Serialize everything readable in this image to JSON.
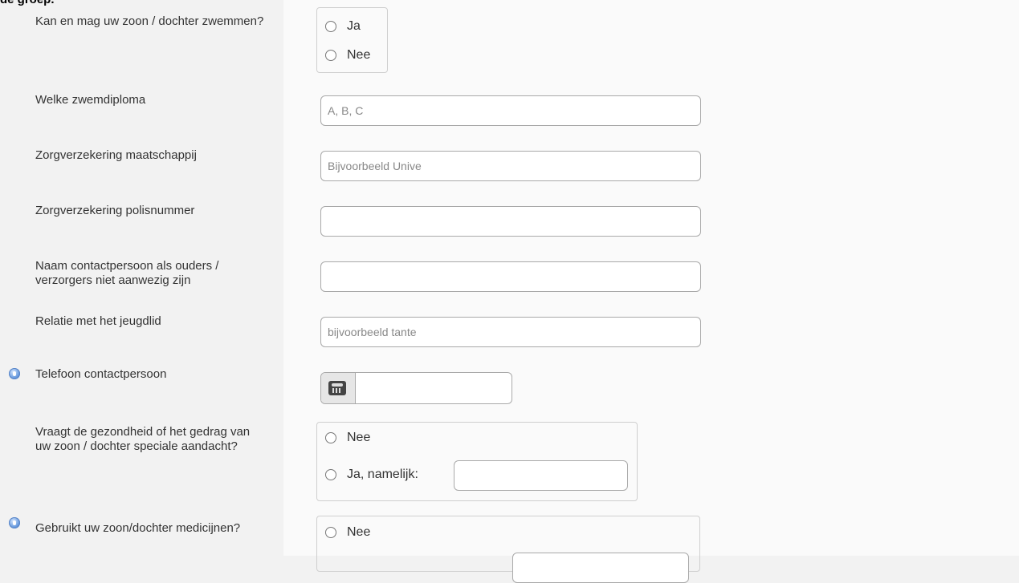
{
  "top_text": "de groep.",
  "questions": {
    "swim": {
      "label": "Kan en mag uw zoon / dochter zwemmen?",
      "options": [
        "Ja",
        "Nee"
      ]
    },
    "diploma": {
      "label": "Welke zwemdiploma",
      "placeholder": "A, B, C"
    },
    "insurer": {
      "label": "Zorgverzekering maatschappij",
      "placeholder": "Bijvoorbeeld Unive"
    },
    "policy": {
      "label": "Zorgverzekering polisnummer",
      "placeholder": ""
    },
    "contact_name": {
      "label": "Naam contactpersoon als ouders / verzorgers niet aanwezig zijn",
      "placeholder": ""
    },
    "relation": {
      "label": "Relatie met het jeugdlid",
      "placeholder": "bijvoorbeeld tante"
    },
    "contact_phone": {
      "label": "Telefoon contactpersoon",
      "placeholder": ""
    },
    "health": {
      "label": "Vraagt de gezondheid of het gedrag van uw zoon / dochter speciale aandacht?",
      "options": [
        "Nee",
        "Ja, namelijk:"
      ]
    },
    "medicine": {
      "label": "Gebruikt uw zoon/dochter medicijnen?",
      "options": [
        "Nee"
      ]
    }
  }
}
